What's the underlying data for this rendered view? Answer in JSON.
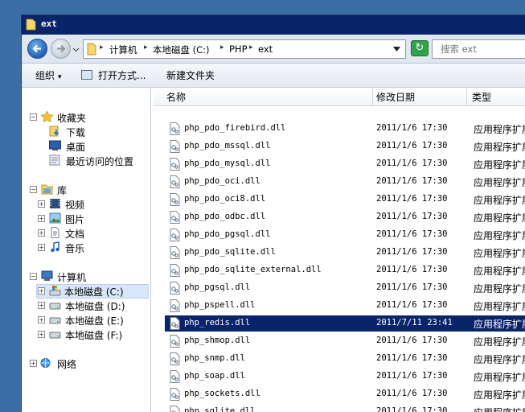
{
  "window": {
    "title": "ext"
  },
  "address": {
    "crumbs": [
      "计算机",
      "本地磁盘 (C:)",
      "PHP",
      "ext"
    ],
    "search_placeholder": "搜索 ext"
  },
  "toolbar": {
    "organize_label": "组织",
    "open_with_label": "打开方式...",
    "new_folder_label": "新建文件夹"
  },
  "nav": {
    "favorites": {
      "label": "收藏夹",
      "items": [
        "下载",
        "桌面",
        "最近访问的位置"
      ]
    },
    "libraries": {
      "label": "库",
      "items": [
        "视频",
        "图片",
        "文档",
        "音乐"
      ]
    },
    "computer": {
      "label": "计算机",
      "items": [
        "本地磁盘 (C:)",
        "本地磁盘 (D:)",
        "本地磁盘 (E:)",
        "本地磁盘 (F:)"
      ]
    },
    "network": {
      "label": "网络"
    }
  },
  "columns": {
    "name": "名称",
    "modified": "修改日期",
    "type": "类型"
  },
  "files": [
    {
      "name": "php_pdo_firebird.dll",
      "date": "2011/1/6 17:30",
      "type": "应用程序扩展"
    },
    {
      "name": "php_pdo_mssql.dll",
      "date": "2011/1/6 17:30",
      "type": "应用程序扩展"
    },
    {
      "name": "php_pdo_mysql.dll",
      "date": "2011/1/6 17:30",
      "type": "应用程序扩展"
    },
    {
      "name": "php_pdo_oci.dll",
      "date": "2011/1/6 17:30",
      "type": "应用程序扩展"
    },
    {
      "name": "php_pdo_oci8.dll",
      "date": "2011/1/6 17:30",
      "type": "应用程序扩展"
    },
    {
      "name": "php_pdo_odbc.dll",
      "date": "2011/1/6 17:30",
      "type": "应用程序扩展"
    },
    {
      "name": "php_pdo_pgsql.dll",
      "date": "2011/1/6 17:30",
      "type": "应用程序扩展"
    },
    {
      "name": "php_pdo_sqlite.dll",
      "date": "2011/1/6 17:30",
      "type": "应用程序扩展"
    },
    {
      "name": "php_pdo_sqlite_external.dll",
      "date": "2011/1/6 17:30",
      "type": "应用程序扩展"
    },
    {
      "name": "php_pgsql.dll",
      "date": "2011/1/6 17:30",
      "type": "应用程序扩展"
    },
    {
      "name": "php_pspell.dll",
      "date": "2011/1/6 17:30",
      "type": "应用程序扩展"
    },
    {
      "name": "php_redis.dll",
      "date": "2011/7/11 23:41",
      "type": "应用程序扩展"
    },
    {
      "name": "php_shmop.dll",
      "date": "2011/1/6 17:30",
      "type": "应用程序扩展"
    },
    {
      "name": "php_snmp.dll",
      "date": "2011/1/6 17:30",
      "type": "应用程序扩展"
    },
    {
      "name": "php_soap.dll",
      "date": "2011/1/6 17:30",
      "type": "应用程序扩展"
    },
    {
      "name": "php_sockets.dll",
      "date": "2011/1/6 17:30",
      "type": "应用程序扩展"
    },
    {
      "name": "php_sqlite.dll",
      "date": "2011/1/6 17:30",
      "type": "应用程序扩展"
    }
  ],
  "colors": {
    "titlebar": "#0a246a",
    "desktop": "#3a6ea5",
    "selection": "#0a246a"
  }
}
